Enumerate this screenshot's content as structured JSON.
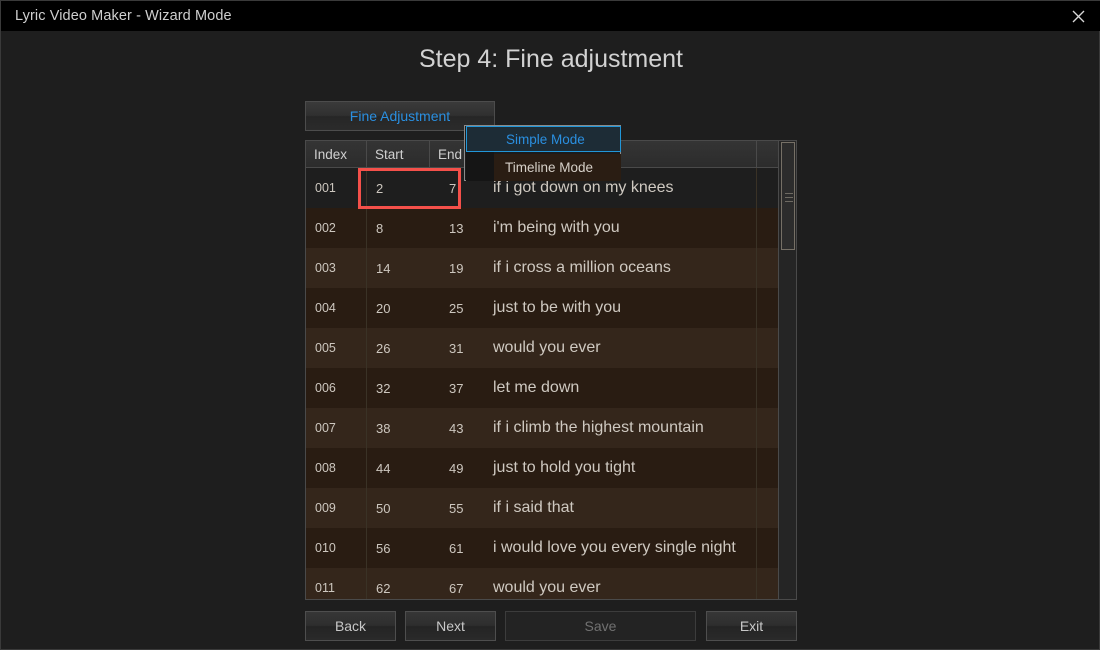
{
  "window": {
    "title": "Lyric Video Maker - Wizard Mode",
    "close_icon": "close-icon"
  },
  "page": {
    "step_title": "Step 4: Fine adjustment"
  },
  "mode_tab": {
    "label": "Fine Adjustment",
    "accent_color": "#2a8fe0"
  },
  "mode_menu": {
    "open": true,
    "items": [
      {
        "label": "Simple Mode",
        "selected": true
      },
      {
        "label": "Timeline Mode",
        "selected": false
      }
    ]
  },
  "table": {
    "columns": [
      "Index",
      "Start",
      "End",
      "",
      ""
    ],
    "selection_outline_color": "#f4504a",
    "rows": [
      {
        "index": "001",
        "start": "2",
        "end": "7",
        "text": "if i got down on my knees"
      },
      {
        "index": "002",
        "start": "8",
        "end": "13",
        "text": "i'm being with you"
      },
      {
        "index": "003",
        "start": "14",
        "end": "19",
        "text": "if i cross a million oceans"
      },
      {
        "index": "004",
        "start": "20",
        "end": "25",
        "text": "just to be with you"
      },
      {
        "index": "005",
        "start": "26",
        "end": "31",
        "text": "would you ever"
      },
      {
        "index": "006",
        "start": "32",
        "end": "37",
        "text": "let me down"
      },
      {
        "index": "007",
        "start": "38",
        "end": "43",
        "text": "if i climb the highest mountain"
      },
      {
        "index": "008",
        "start": "44",
        "end": "49",
        "text": "just to hold you tight"
      },
      {
        "index": "009",
        "start": "50",
        "end": "55",
        "text": "if i said that"
      },
      {
        "index": "010",
        "start": "56",
        "end": "61",
        "text": "i would love you every single night"
      },
      {
        "index": "011",
        "start": "62",
        "end": "67",
        "text": "would you ever"
      }
    ]
  },
  "scrollbar": {
    "orientation": "vertical",
    "thumb_position": "top"
  },
  "footer": {
    "back_label": "Back",
    "next_label": "Next",
    "save_label": "Save",
    "save_disabled": true,
    "exit_label": "Exit"
  }
}
